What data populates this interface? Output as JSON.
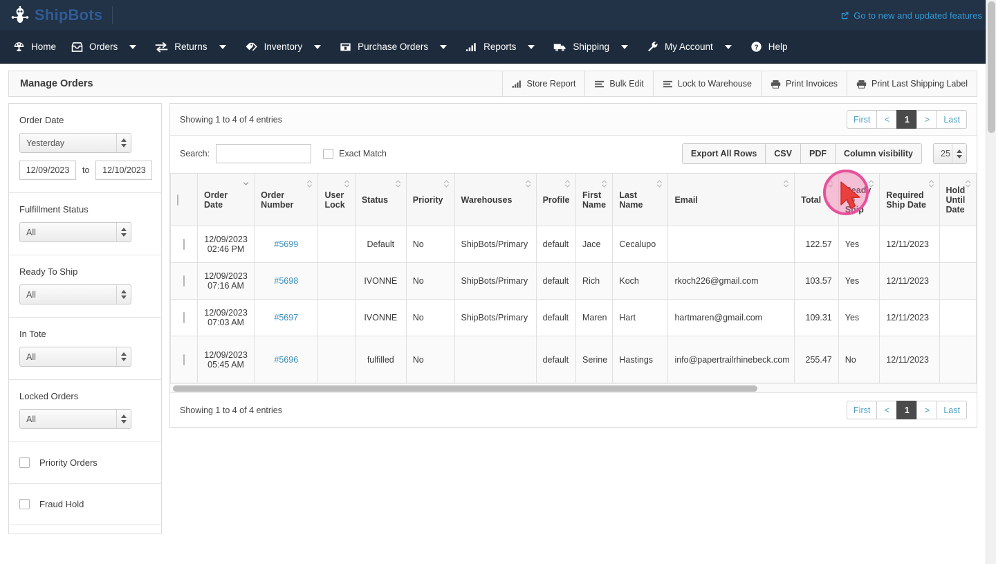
{
  "brand": {
    "name": "ShipBots",
    "logo_icon": "robot-icon",
    "features_link": "Go to new and updated features",
    "features_icon": "external-link-icon",
    "accent_color": "#2f9ad6",
    "brand_color": "#2f5c94",
    "bar_color": "#223247"
  },
  "nav": {
    "items": [
      {
        "label": "Home",
        "icon": "dashboard-icon",
        "has_caret": false
      },
      {
        "label": "Orders",
        "icon": "inbox-icon",
        "has_caret": true
      },
      {
        "label": "Returns",
        "icon": "exchange-icon",
        "has_caret": true
      },
      {
        "label": "Inventory",
        "icon": "tag-icon",
        "has_caret": true
      },
      {
        "label": "Purchase Orders",
        "icon": "box-icon",
        "has_caret": true
      },
      {
        "label": "Reports",
        "icon": "bar-chart-icon",
        "has_caret": true
      },
      {
        "label": "Shipping",
        "icon": "truck-icon",
        "has_caret": true
      },
      {
        "label": "My Account",
        "icon": "wrench-icon",
        "has_caret": true
      },
      {
        "label": "Help",
        "icon": "question-circle-icon",
        "has_caret": false
      }
    ]
  },
  "pagebar": {
    "title": "Manage Orders",
    "actions": [
      {
        "label": "Store Report",
        "icon": "bar-chart-icon"
      },
      {
        "label": "Bulk Edit",
        "icon": "list-icon"
      },
      {
        "label": "Lock to Warehouse",
        "icon": "list-icon"
      },
      {
        "label": "Print Invoices",
        "icon": "printer-icon"
      },
      {
        "label": "Print Last Shipping Label",
        "icon": "printer-icon"
      }
    ]
  },
  "sidebar": {
    "order_date": {
      "label": "Order Date",
      "preset": "Yesterday",
      "from": "12/09/2023",
      "to_label": "to",
      "to": "12/10/2023"
    },
    "selects": [
      {
        "label": "Fulfillment Status",
        "value": "All"
      },
      {
        "label": "Ready To Ship",
        "value": "All"
      },
      {
        "label": "In Tote",
        "value": "All"
      },
      {
        "label": "Locked Orders",
        "value": "All"
      }
    ],
    "checkboxes": [
      {
        "label": "Priority Orders",
        "checked": false
      },
      {
        "label": "Fraud Hold",
        "checked": false
      }
    ]
  },
  "panel": {
    "entries_top": "Showing 1 to 4 of 4 entries",
    "entries_bottom": "Showing 1 to 4 of 4 entries",
    "pager": {
      "first": "First",
      "prev": "<",
      "current": "1",
      "next": ">",
      "last": "Last"
    },
    "search": {
      "label": "Search:",
      "value": "",
      "placeholder": ""
    },
    "exact_match": {
      "label": "Exact Match",
      "checked": false
    },
    "buttons": [
      {
        "label": "Export All Rows",
        "name": "export-all-rows-button"
      },
      {
        "label": "CSV",
        "name": "csv-button"
      },
      {
        "label": "PDF",
        "name": "pdf-button"
      },
      {
        "label": "Column visibility",
        "name": "column-visibility-button",
        "highlighted": true
      }
    ],
    "page_length": "25"
  },
  "table": {
    "columns": [
      {
        "label": "",
        "name": "select-all",
        "sort": "none"
      },
      {
        "label": "Order Date",
        "name": "order-date",
        "sort": "desc"
      },
      {
        "label": "Order Number",
        "name": "order-number",
        "sort": "both"
      },
      {
        "label": "User Lock",
        "name": "user-lock",
        "sort": "both"
      },
      {
        "label": "Status",
        "name": "status",
        "sort": "both"
      },
      {
        "label": "Priority",
        "name": "priority",
        "sort": "both"
      },
      {
        "label": "Warehouses",
        "name": "warehouses",
        "sort": "both"
      },
      {
        "label": "Profile",
        "name": "profile",
        "sort": "both"
      },
      {
        "label": "First Name",
        "name": "first-name",
        "sort": "both"
      },
      {
        "label": "Last Name",
        "name": "last-name",
        "sort": "both"
      },
      {
        "label": "Email",
        "name": "email",
        "sort": "both"
      },
      {
        "label": "Total",
        "name": "total",
        "sort": "both"
      },
      {
        "label": "Ready To Ship",
        "name": "ready-to-ship",
        "sort": "both"
      },
      {
        "label": "Required Ship Date",
        "name": "required-ship-date",
        "sort": "both"
      },
      {
        "label": "Hold Until Date",
        "name": "hold-until-date",
        "sort": "both"
      }
    ],
    "rows": [
      {
        "date": "12/09/2023",
        "time": "02:46 PM",
        "order_number": "#5699",
        "user_lock": "",
        "status": "Default",
        "priority": "No",
        "warehouses": "ShipBots/Primary",
        "profile": "default",
        "first_name": "Jace",
        "last_name": "Cecalupo",
        "email": "",
        "total": "122.57",
        "ready_to_ship": "Yes",
        "required_ship_date": "12/11/2023",
        "hold_until_date": ""
      },
      {
        "date": "12/09/2023",
        "time": "07:16 AM",
        "order_number": "#5698",
        "user_lock": "",
        "status": "IVONNE",
        "priority": "No",
        "warehouses": "ShipBots/Primary",
        "profile": "default",
        "first_name": "Rich",
        "last_name": "Koch",
        "email": "rkoch226@gmail.com",
        "total": "103.57",
        "ready_to_ship": "Yes",
        "required_ship_date": "12/11/2023",
        "hold_until_date": ""
      },
      {
        "date": "12/09/2023",
        "time": "07:03 AM",
        "order_number": "#5697",
        "user_lock": "",
        "status": "IVONNE",
        "priority": "No",
        "warehouses": "ShipBots/Primary",
        "profile": "default",
        "first_name": "Maren",
        "last_name": "Hart",
        "email": "hartmaren@gmail.com",
        "total": "109.31",
        "ready_to_ship": "Yes",
        "required_ship_date": "12/11/2023",
        "hold_until_date": ""
      },
      {
        "date": "12/09/2023",
        "time": "05:45 AM",
        "order_number": "#5696",
        "user_lock": "",
        "status": "fulfilled",
        "priority": "No",
        "warehouses": "",
        "profile": "default",
        "first_name": "Serine",
        "last_name": "Hastings",
        "email": "info@papertrailrhinebeck.com",
        "total": "255.47",
        "ready_to_ship": "No",
        "required_ship_date": "12/11/2023",
        "hold_until_date": ""
      }
    ]
  },
  "cursor": {
    "icon": "mouse-pointer-icon",
    "ring_color": "#e8509a"
  }
}
